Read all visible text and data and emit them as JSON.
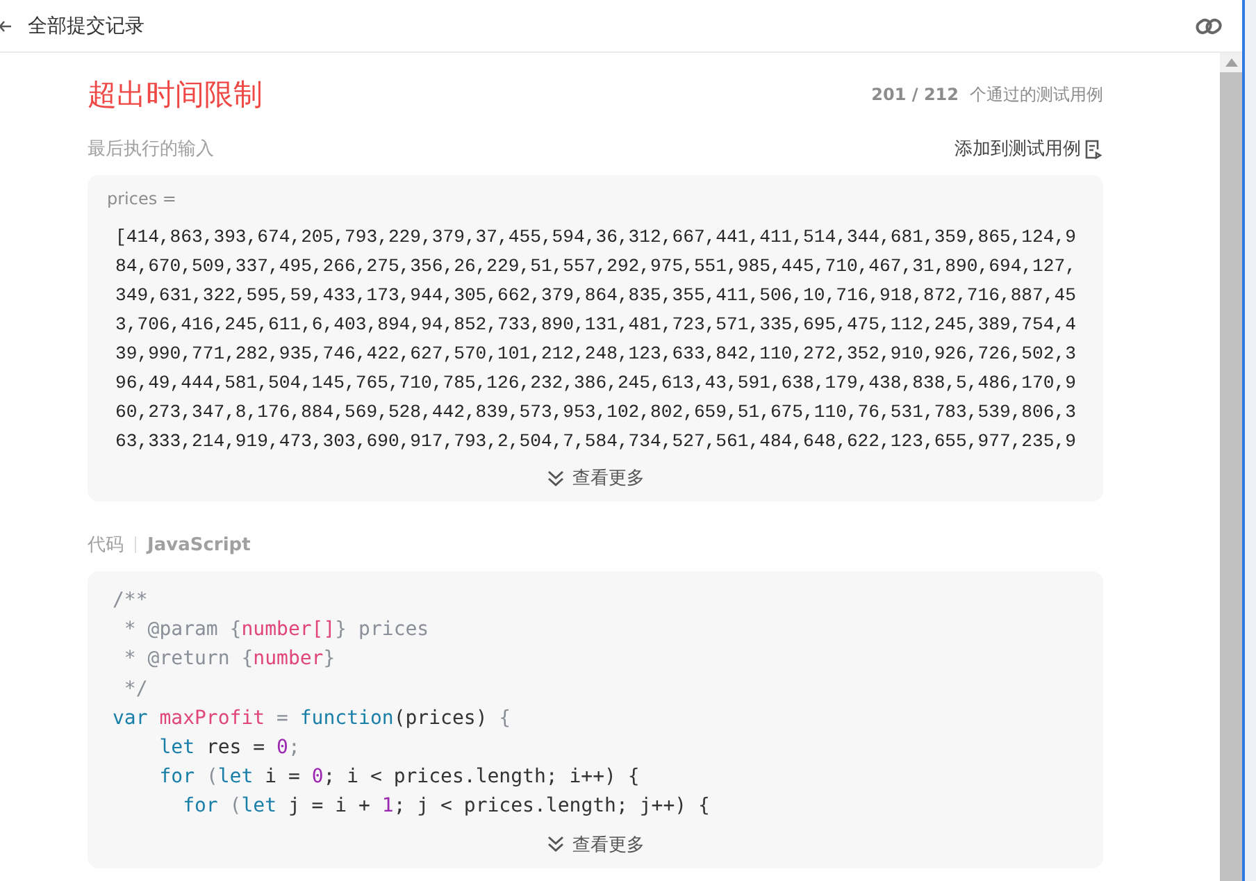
{
  "header": {
    "title": "全部提交记录"
  },
  "result": {
    "status": "超出时间限制",
    "passed": "201 / 212",
    "passed_label": "个通过的测试用例"
  },
  "input": {
    "label": "最后执行的输入",
    "add_button": "添加到测试用例",
    "var_name": "prices =",
    "lines": [
      "[414,863,393,674,205,793,229,379,37,455,594,36,312,667,441,411,514,344,681,359,865,124,9",
      "84,670,509,337,495,266,275,356,26,229,51,557,292,975,551,985,445,710,467,31,890,694,127,",
      "349,631,322,595,59,433,173,944,305,662,379,864,835,355,411,506,10,716,918,872,716,887,45",
      "3,706,416,245,611,6,403,894,94,852,733,890,131,481,723,571,335,695,475,112,245,389,754,4",
      "39,990,771,282,935,746,422,627,570,101,212,248,123,633,842,110,272,352,910,926,726,502,3",
      "96,49,444,581,504,145,765,710,785,126,232,386,245,613,43,591,638,179,438,838,5,486,170,9",
      "60,273,347,8,176,884,569,528,442,839,573,953,102,802,659,51,675,110,76,531,783,539,806,3",
      "63,333,214,919,473,303,690,917,793,2,504,7,584,734,527,561,484,648,622,123,655,977,235,9"
    ],
    "more": "查看更多"
  },
  "code": {
    "label": "代码",
    "language": "JavaScript",
    "more": "查看更多",
    "lines": [
      [
        {
          "t": "/**",
          "kind": "comment"
        }
      ],
      [
        {
          "t": " * @param ",
          "kind": "comment"
        },
        {
          "t": "{",
          "kind": "punct"
        },
        {
          "t": "number[]",
          "kind": "type"
        },
        {
          "t": "} prices",
          "kind": "comment"
        }
      ],
      [
        {
          "t": " * @return ",
          "kind": "comment"
        },
        {
          "t": "{",
          "kind": "punct"
        },
        {
          "t": "number",
          "kind": "type"
        },
        {
          "t": "}",
          "kind": "punct"
        }
      ],
      [
        {
          "t": " */",
          "kind": "comment"
        }
      ],
      [
        {
          "t": "var ",
          "kind": "keyword"
        },
        {
          "t": "maxProfit",
          "kind": "name"
        },
        {
          "t": " = ",
          "kind": "punct"
        },
        {
          "t": "function",
          "kind": "keyword"
        },
        {
          "t": "(prices) ",
          "kind": "plain"
        },
        {
          "t": "{",
          "kind": "punct"
        }
      ],
      [
        {
          "t": "    let ",
          "kind": "keyword"
        },
        {
          "t": "res = ",
          "kind": "plain"
        },
        {
          "t": "0",
          "kind": "number"
        },
        {
          "t": ";",
          "kind": "punct"
        }
      ],
      [
        {
          "t": "    for ",
          "kind": "keyword"
        },
        {
          "t": "(",
          "kind": "punct"
        },
        {
          "t": "let ",
          "kind": "keyword"
        },
        {
          "t": "i = ",
          "kind": "plain"
        },
        {
          "t": "0",
          "kind": "number"
        },
        {
          "t": "; i < prices.length; i++) {",
          "kind": "plain"
        }
      ],
      [
        {
          "t": "      for ",
          "kind": "keyword"
        },
        {
          "t": "(",
          "kind": "punct"
        },
        {
          "t": "let ",
          "kind": "keyword"
        },
        {
          "t": "j = i + ",
          "kind": "plain"
        },
        {
          "t": "1",
          "kind": "number"
        },
        {
          "t": "; j < prices.length; j++) {",
          "kind": "plain"
        }
      ]
    ]
  }
}
